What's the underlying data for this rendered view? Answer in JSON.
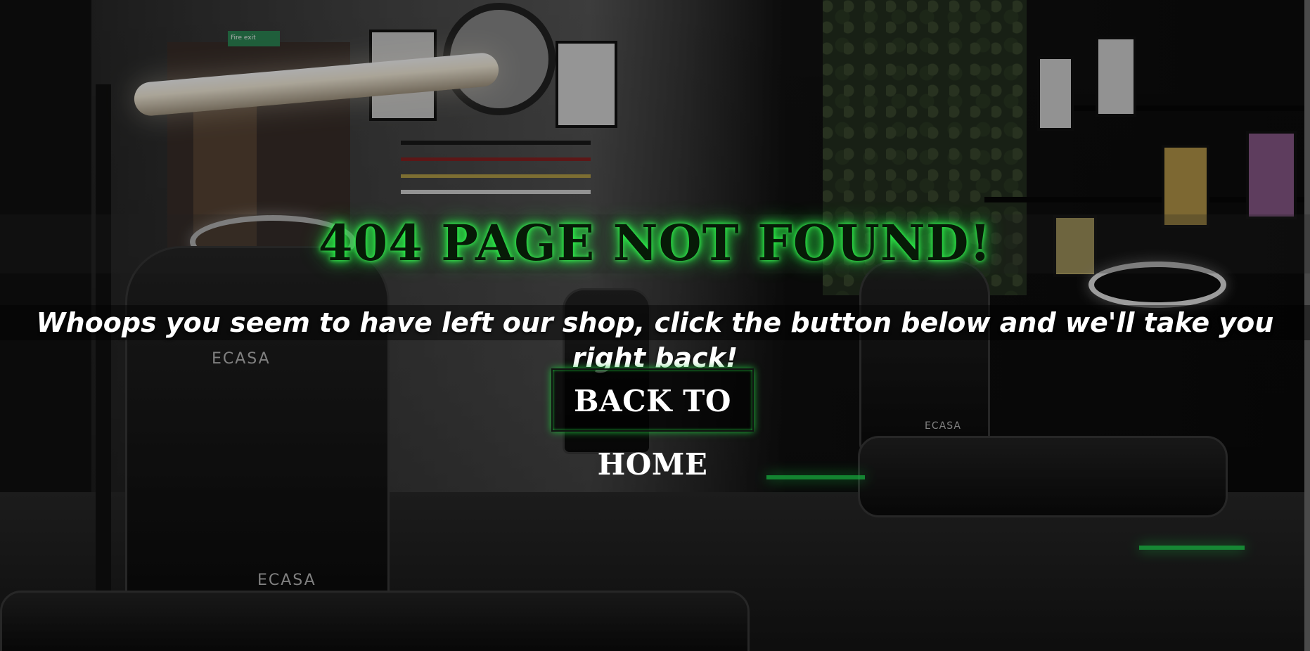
{
  "page": {
    "title": "404 PAGE NOT FOUND!",
    "message": "Whoops you seem to have left our shop, click the button below and we'll take you right back!",
    "button_label": "BACK TO HOME"
  },
  "background": {
    "scene": "tattoo-studio-photo",
    "fire_exit_sign": "Fire exit",
    "chair_brand_left": "ECASA",
    "chair_brand_left_lower": "ECASA",
    "chair_brand_right": "ECASA"
  },
  "colors": {
    "accent_glow": "#29ff4a",
    "title_text": "#071a07",
    "message_text": "#ffffff",
    "button_bg": "#000000",
    "button_text": "#ffffff"
  }
}
